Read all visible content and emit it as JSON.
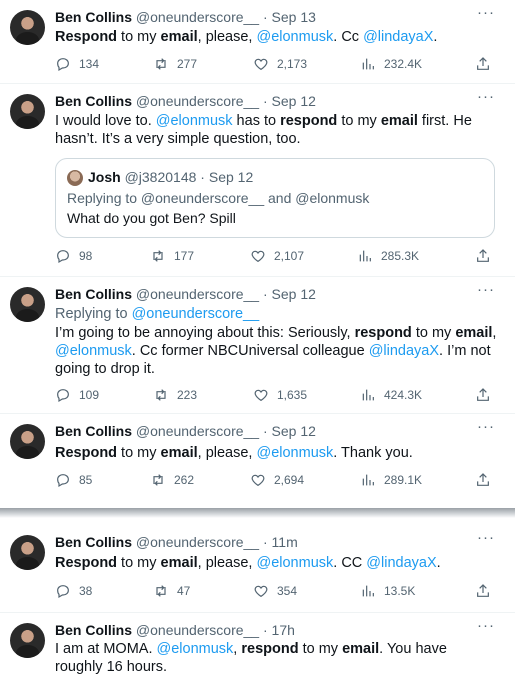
{
  "tweets": [
    {
      "name": "Ben Collins",
      "handle": "@oneunderscore__",
      "sep": "·",
      "time": "Sep 13",
      "body": [
        {
          "t": "Respond",
          "s": "b"
        },
        {
          "t": " to my ",
          "s": "n"
        },
        {
          "t": "email",
          "s": "b"
        },
        {
          "t": ", please, ",
          "s": "n"
        },
        {
          "t": "@elonmusk",
          "s": "m"
        },
        {
          "t": ". Cc ",
          "s": "n"
        },
        {
          "t": "@lindayaX",
          "s": "m"
        },
        {
          "t": ".",
          "s": "n"
        }
      ],
      "replies": "134",
      "retweets": "277",
      "likes": "2,173",
      "views": "232.4K"
    },
    {
      "name": "Ben Collins",
      "handle": "@oneunderscore__",
      "sep": "·",
      "time": "Sep 12",
      "body": [
        {
          "t": "I would love to. ",
          "s": "n"
        },
        {
          "t": "@elonmusk",
          "s": "m"
        },
        {
          "t": " has to ",
          "s": "n"
        },
        {
          "t": "respond",
          "s": "b"
        },
        {
          "t": " to my ",
          "s": "n"
        },
        {
          "t": "email",
          "s": "b"
        },
        {
          "t": " first. He hasn’t. It’s a very simple question, too.",
          "s": "n"
        }
      ],
      "quote": {
        "name": "Josh",
        "handle": "@j3820148",
        "sep": "·",
        "time": "Sep 12",
        "replying": "Replying to @oneunderscore__ and @elonmusk",
        "text": "What do you got Ben? Spill"
      },
      "replies": "98",
      "retweets": "177",
      "likes": "2,107",
      "views": "285.3K"
    },
    {
      "name": "Ben Collins",
      "handle": "@oneunderscore__",
      "sep": "·",
      "time": "Sep 12",
      "replying_prefix": "Replying to ",
      "replying_to": "@oneunderscore__",
      "body": [
        {
          "t": "I’m going to be annoying about this: Seriously, ",
          "s": "n"
        },
        {
          "t": "respond",
          "s": "b"
        },
        {
          "t": " to my ",
          "s": "n"
        },
        {
          "t": "email",
          "s": "b"
        },
        {
          "t": ", ",
          "s": "n"
        },
        {
          "t": "@elonmusk",
          "s": "m"
        },
        {
          "t": ". Cc former NBCUniversal colleague ",
          "s": "n"
        },
        {
          "t": "@lindayaX",
          "s": "m"
        },
        {
          "t": ". I’m not going to drop it.",
          "s": "n"
        }
      ],
      "replies": "109",
      "retweets": "223",
      "likes": "1,635",
      "views": "424.3K"
    },
    {
      "name": "Ben Collins",
      "handle": "@oneunderscore__",
      "sep": "·",
      "time": "Sep 12",
      "body": [
        {
          "t": "Respond",
          "s": "b"
        },
        {
          "t": " to my ",
          "s": "n"
        },
        {
          "t": "email",
          "s": "b"
        },
        {
          "t": ", please, ",
          "s": "n"
        },
        {
          "t": "@elonmusk",
          "s": "m"
        },
        {
          "t": ". Thank you.",
          "s": "n"
        }
      ],
      "replies": "85",
      "retweets": "262",
      "likes": "2,694",
      "views": "289.1K"
    },
    {
      "name": "Ben Collins",
      "handle": "@oneunderscore__",
      "sep": "·",
      "time": "11m",
      "body": [
        {
          "t": "Respond",
          "s": "b"
        },
        {
          "t": " to my ",
          "s": "n"
        },
        {
          "t": "email",
          "s": "b"
        },
        {
          "t": ", please, ",
          "s": "n"
        },
        {
          "t": "@elonmusk",
          "s": "m"
        },
        {
          "t": ". CC ",
          "s": "n"
        },
        {
          "t": "@lindayaX",
          "s": "m"
        },
        {
          "t": ".",
          "s": "n"
        }
      ],
      "replies": "38",
      "retweets": "47",
      "likes": "354",
      "views": "13.5K"
    },
    {
      "name": "Ben Collins",
      "handle": "@oneunderscore__",
      "sep": "·",
      "time": "17h",
      "body": [
        {
          "t": "I am at MOMA. ",
          "s": "n"
        },
        {
          "t": "@elonmusk",
          "s": "m"
        },
        {
          "t": ", ",
          "s": "n"
        },
        {
          "t": "respond",
          "s": "b"
        },
        {
          "t": " to my ",
          "s": "n"
        },
        {
          "t": "email",
          "s": "b"
        },
        {
          "t": ". You have roughly 16 hours.",
          "s": "n"
        }
      ]
    }
  ],
  "more_glyph": "···",
  "icons": [
    "reply-icon",
    "retweet-icon",
    "like-icon",
    "views-icon",
    "share-icon",
    "more-icon"
  ],
  "colors": {
    "text": "#0f1419",
    "muted": "#536471",
    "link": "#1d9bf0",
    "border": "#eff3f4"
  }
}
